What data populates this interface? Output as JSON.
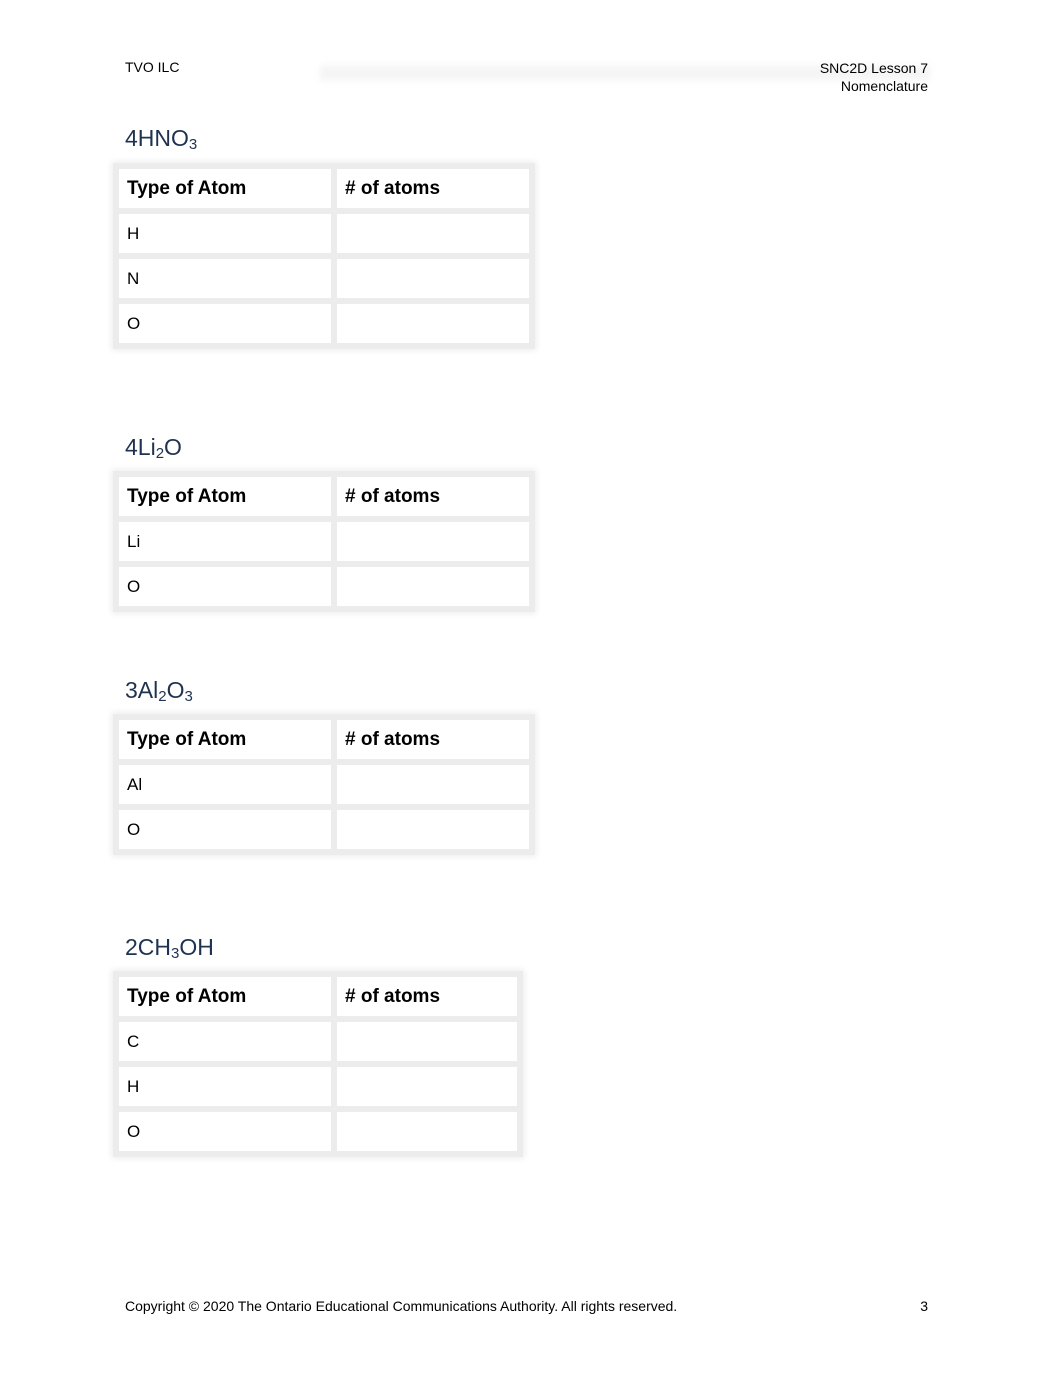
{
  "header": {
    "left": "TVO ILC",
    "right_line1": "SNC2D Lesson 7",
    "right_line2": "Nomenclature"
  },
  "table_headers": {
    "type": "Type of Atom",
    "count": "# of atoms"
  },
  "exercises": [
    {
      "coef": "4",
      "parts": [
        [
          "HNO",
          ""
        ],
        [
          "",
          "3"
        ]
      ],
      "formula": "4HNO3",
      "atoms": [
        "H",
        "N",
        "O"
      ],
      "counts": [
        "",
        "",
        ""
      ]
    },
    {
      "coef": "4",
      "formula": "4Li2O",
      "atoms": [
        "Li",
        "O"
      ],
      "counts": [
        "",
        ""
      ]
    },
    {
      "coef": "3",
      "formula": "3Al2O3",
      "atoms": [
        "Al",
        "O"
      ],
      "counts": [
        "",
        ""
      ]
    },
    {
      "coef": "2",
      "formula": "2CH3OH",
      "atoms": [
        "C",
        "H",
        "O"
      ],
      "counts": [
        "",
        "",
        ""
      ]
    }
  ],
  "formula_text": {
    "f1": {
      "a": "4HNO",
      "s1": "3"
    },
    "f2": {
      "a": "4Li",
      "s1": "2",
      "b": "O"
    },
    "f3": {
      "a": "3Al",
      "s1": "2",
      "b": "O",
      "s2": "3"
    },
    "f4": {
      "a": "2CH",
      "s1": "3",
      "b": "OH"
    }
  },
  "footer": {
    "copyright": "Copyright © 2020 The Ontario Educational Communications Authority. All rights reserved.",
    "page_number": "3"
  }
}
